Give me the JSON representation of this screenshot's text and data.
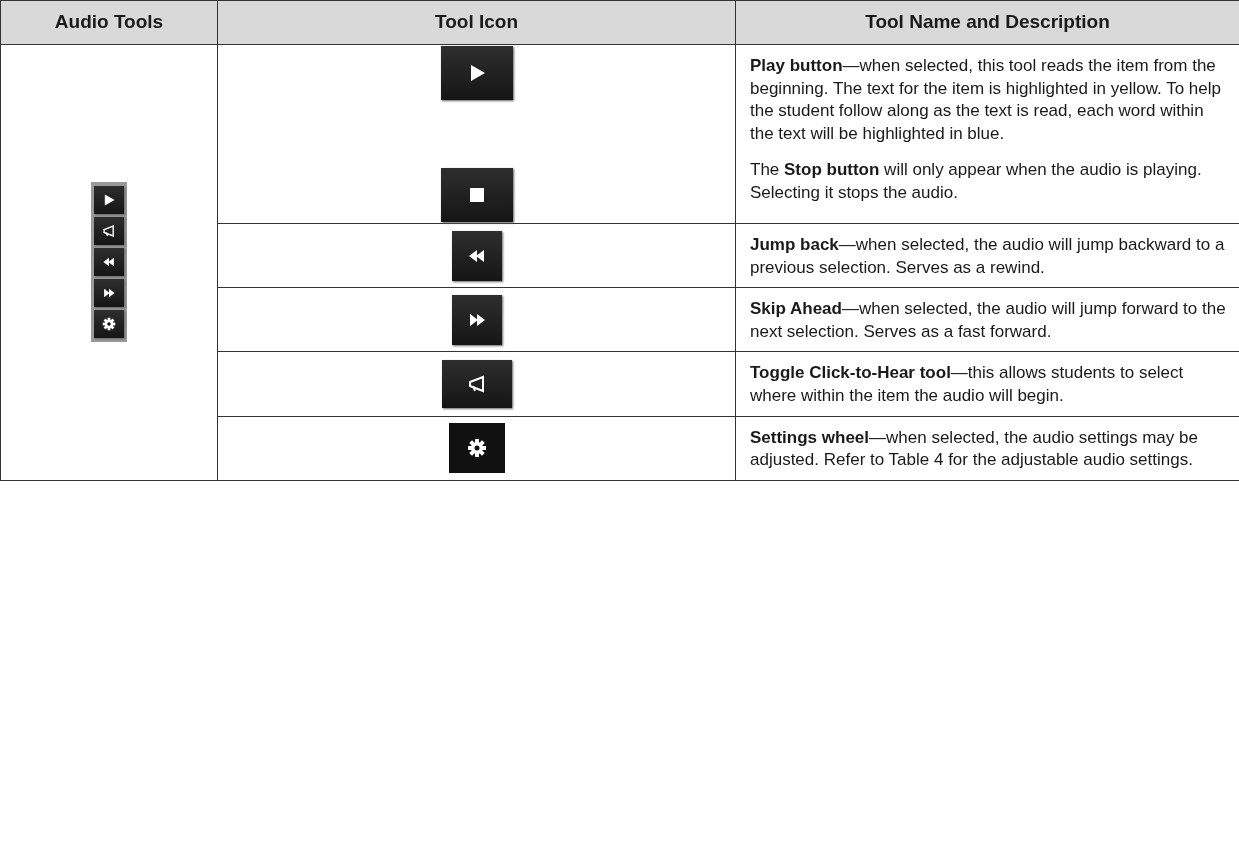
{
  "table": {
    "columns": [
      "Audio Tools",
      "Tool Icon",
      "Tool Name and Description"
    ],
    "toolbar": [
      {
        "kind": "play"
      },
      {
        "kind": "megaphone"
      },
      {
        "kind": "rewind"
      },
      {
        "kind": "forward"
      },
      {
        "kind": "gear"
      }
    ],
    "rows": [
      {
        "icons": [
          {
            "kind": "play"
          },
          {
            "kind": "stop"
          }
        ],
        "descriptions": [
          "**Play button**—when selected, this tool reads the item from the beginning. The text for the item is highlighted in yellow. To help the student follow along as the text is read, each word within the text will be highlighted in blue.",
          "The **Stop button** will only appear when the audio is playing. Selecting it stops the audio."
        ]
      },
      {
        "icons": [
          {
            "kind": "rewind"
          }
        ],
        "descriptions": [
          "**Jump back**—when selected, the audio will jump backward to a previous selection. Serves as a rewind."
        ]
      },
      {
        "icons": [
          {
            "kind": "forward"
          }
        ],
        "descriptions": [
          "**Skip Ahead**—when selected, the audio will jump forward to the next selection. Serves as a fast forward."
        ]
      },
      {
        "icons": [
          {
            "kind": "megaphone"
          }
        ],
        "descriptions": [
          "**Toggle Click-to-Hear tool**—this allows students to select where within the item the audio will begin."
        ]
      },
      {
        "icons": [
          {
            "kind": "gear"
          }
        ],
        "descriptions": [
          "**Settings wheel**—when selected, the audio settings may be adjusted. Refer to Table 4 for the adjustable audio settings."
        ]
      }
    ]
  }
}
